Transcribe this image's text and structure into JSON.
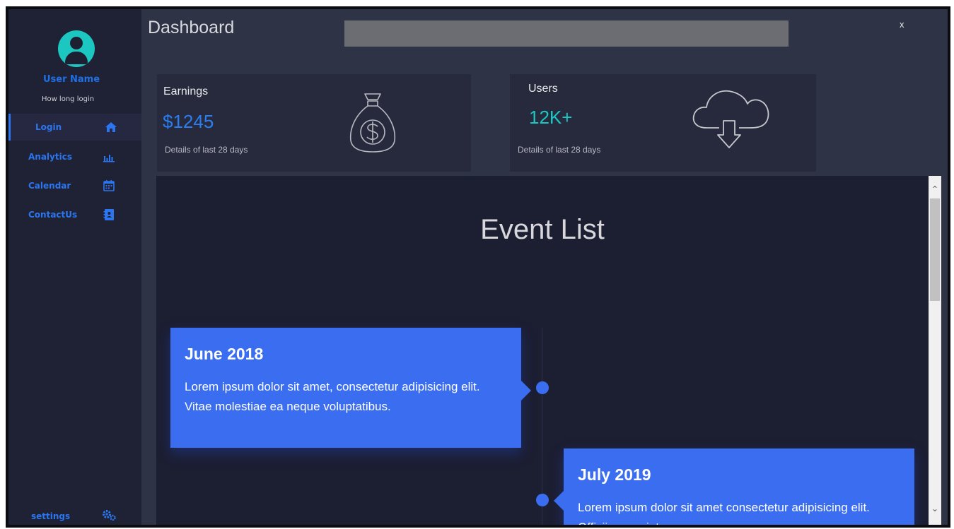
{
  "sidebar": {
    "user_name": "User Name",
    "login_time": "How long login",
    "items": [
      {
        "label": "Login",
        "icon": "home-icon"
      },
      {
        "label": "Analytics",
        "icon": "bar-chart-icon"
      },
      {
        "label": "Calendar",
        "icon": "calendar-icon"
      },
      {
        "label": "ContactUs",
        "icon": "contact-book-icon"
      }
    ],
    "settings_label": "settings",
    "settings_icon": "gears-icon"
  },
  "header": {
    "title": "Dashboard",
    "search_value": "",
    "close_label": "x"
  },
  "cards": {
    "earnings": {
      "title": "Earnings",
      "value": "$1245",
      "detail": "Details of last 28 days",
      "icon": "money-bag-icon",
      "value_color": "#2a7ef0"
    },
    "users": {
      "title": "Users",
      "value": "12K+",
      "detail": "Details of last 28 days",
      "icon": "cloud-download-icon",
      "value_color": "#1cc7c2"
    }
  },
  "events": {
    "heading": "Event List",
    "items": [
      {
        "title": "June 2018",
        "text": "Lorem ipsum dolor sit amet, consectetur adipisicing elit. Vitae molestiae ea neque voluptatibus."
      },
      {
        "title": "July 2019",
        "text": "Lorem ipsum dolor sit amet consectetur adipisicing elit. Officiis, eveniet"
      }
    ]
  },
  "scrollbar": {
    "up_icon": "chevron-up-icon",
    "down_icon": "chevron-down-icon"
  },
  "colors": {
    "accent": "#3a6df0",
    "teal": "#1cc7c2",
    "sidebar_bg": "#1f2235",
    "panel_bg": "#1c1e32"
  }
}
